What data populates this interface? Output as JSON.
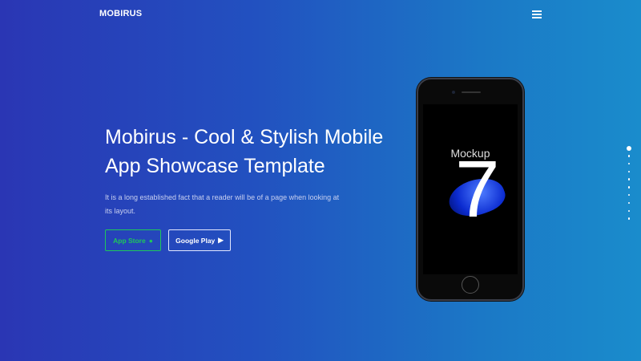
{
  "header": {
    "logo": "MOBIRUS",
    "menu_icon": "hamburger-icon"
  },
  "hero": {
    "title": "Mobirus - Cool & Stylish Mobile App Showcase Template",
    "description": "It is a long established fact that a reader will be of a page when looking at its layout.",
    "buttons": [
      {
        "label": "App Store",
        "icon": "apple-icon",
        "color": "#1ec85a"
      },
      {
        "label": "Google Play",
        "icon": "play-icon",
        "color": "#ffffff"
      }
    ]
  },
  "phone": {
    "screen_text": "Mockup",
    "screen_number": "7"
  },
  "slider": {
    "total": 10,
    "active": 1
  }
}
